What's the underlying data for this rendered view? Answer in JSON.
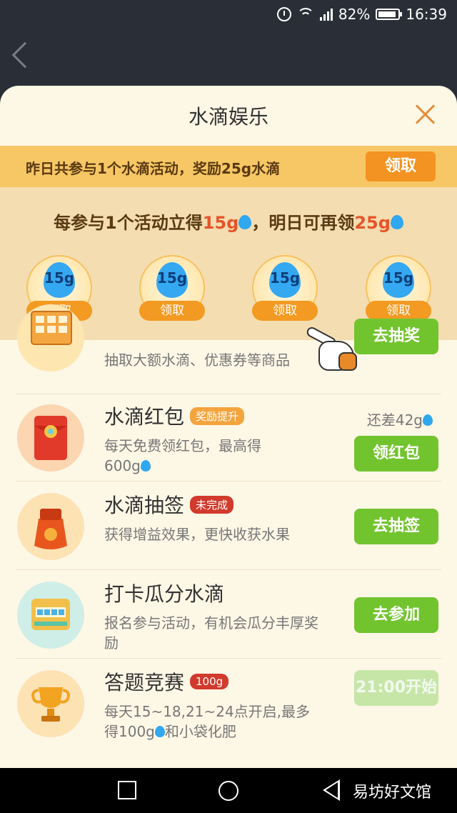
{
  "status_bar": {
    "battery": "82%",
    "time": "16:39",
    "network": "4G"
  },
  "sheet": {
    "title": "水滴娱乐"
  },
  "yesterday": {
    "text": "昨日共参与1个水滴活动，奖励25g水滴",
    "claim_label": "领取"
  },
  "reward": {
    "headline_prefix": "每参与1个活动立得",
    "headline_amount_1": "15g",
    "headline_middle": "，明日可再领",
    "headline_amount_2": "25g",
    "badges": [
      {
        "amount": "15g",
        "label": "领取"
      },
      {
        "amount": "15g",
        "label": "领取"
      },
      {
        "amount": "15g",
        "label": "领取"
      },
      {
        "amount": "15g",
        "label": "领取"
      }
    ]
  },
  "tasks": [
    {
      "title": "",
      "tag": "",
      "desc": "抽取大额水滴、优惠券等商品",
      "button": "去抽奖"
    },
    {
      "title": "水滴红包",
      "tag": "奖励提升",
      "desc_line1": "每天免费领红包，最高得",
      "desc_line2": "600g",
      "extra": "还差42g",
      "button": "领红包"
    },
    {
      "title": "水滴抽签",
      "tag": "未完成",
      "desc": "获得增益效果，更快收获水果",
      "button": "去抽签"
    },
    {
      "title": "打卡瓜分水滴",
      "tag": "",
      "desc": "报名参与活动，有机会瓜分丰厚奖励",
      "button": "去参加"
    },
    {
      "title": "答题竞赛",
      "tag": "100g",
      "desc_line1": "每天15~18,21~24点开启,最多",
      "desc_line2": "得100g",
      "desc_line3": "和小袋化肥",
      "button": "21:00开始"
    }
  ],
  "watermark": "易坊好文馆",
  "colors": {
    "accent_orange": "#f39321",
    "button_green": "#72c42e",
    "sheet_bg": "#fdf7e6",
    "highlight_red": "#e5552a"
  }
}
